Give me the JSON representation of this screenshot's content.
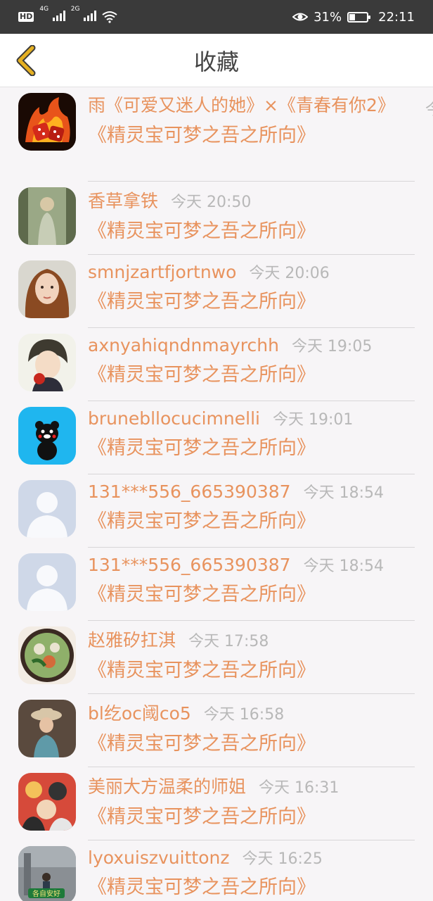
{
  "status_bar": {
    "hd": "HD",
    "net1": "4G",
    "net2": "2G",
    "battery_pct": "31%",
    "time": "22:11",
    "battery_level": 0.31
  },
  "header": {
    "title": "收藏",
    "back_icon": "chevron-left-icon",
    "accent": "#e5b022"
  },
  "items": [
    {
      "name": "雨《可爱又迷人的她》×《青春有你2》",
      "time": "今",
      "subtitle": "《精灵宝可梦之吾之所向》",
      "avatar": "fire-dice"
    },
    {
      "name": "香草拿铁",
      "time": "今天 20:50",
      "subtitle": "《精灵宝可梦之吾之所向》",
      "avatar": "girl-green"
    },
    {
      "name": "smnjzartfjortnwo",
      "time": "今天 20:06",
      "subtitle": "《精灵宝可梦之吾之所向》",
      "avatar": "woman-portrait"
    },
    {
      "name": "axnyahiqndnmayrchh",
      "time": "今天 19:05",
      "subtitle": "《精灵宝可梦之吾之所向》",
      "avatar": "anime-boy"
    },
    {
      "name": "brunebllocucimnelli",
      "time": "今天 19:01",
      "subtitle": "《精灵宝可梦之吾之所向》",
      "avatar": "kumamon"
    },
    {
      "name": "131***556_665390387",
      "time": "今天 18:54",
      "subtitle": "《精灵宝可梦之吾之所向》",
      "avatar": "default-user"
    },
    {
      "name": "131***556_665390387",
      "time": "今天 18:54",
      "subtitle": "《精灵宝可梦之吾之所向》",
      "avatar": "default-user"
    },
    {
      "name": "赵雅矽扛淇",
      "time": "今天 17:58",
      "subtitle": "《精灵宝可梦之吾之所向》",
      "avatar": "food-bowl"
    },
    {
      "name": "bl纥oc阈co5",
      "time": "今天 16:58",
      "subtitle": "《精灵宝可梦之吾之所向》",
      "avatar": "girl-hat"
    },
    {
      "name": "美丽大方温柔的师姐",
      "time": "今天 16:31",
      "subtitle": "《精灵宝可梦之吾之所向》",
      "avatar": "anime-group"
    },
    {
      "name": "lyoxuiszvuittonz",
      "time": "今天 16:25",
      "subtitle": "《精灵宝可梦之吾之所向》",
      "avatar": "street-sign",
      "avatar_text": "各自安好"
    }
  ]
}
